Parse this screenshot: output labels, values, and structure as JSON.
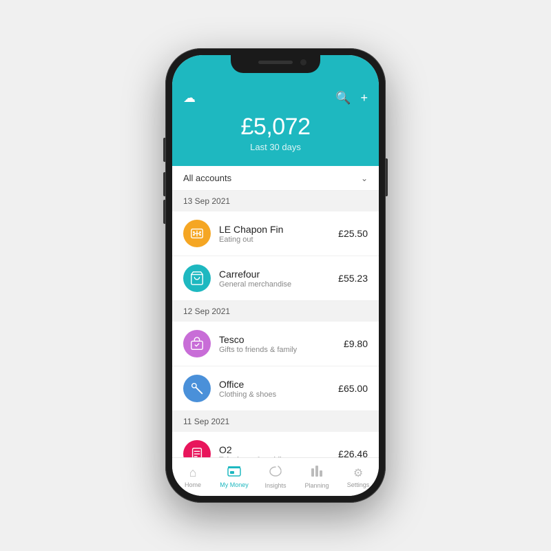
{
  "phone": {
    "header": {
      "cloud_icon": "☁",
      "search_icon": "🔍",
      "add_icon": "+",
      "balance": "£5,072",
      "balance_label": "Last 30 days"
    },
    "filter": {
      "label": "All accounts",
      "chevron": "⌄"
    },
    "sections": [
      {
        "date": "13 Sep 2021",
        "transactions": [
          {
            "name": "LE Chapon Fin",
            "category": "Eating out",
            "amount": "£25.50",
            "icon_color": "orange",
            "icon_emoji": "🍽"
          },
          {
            "name": "Carrefour",
            "category": "General merchandise",
            "amount": "£55.23",
            "icon_color": "teal",
            "icon_emoji": "🧺"
          }
        ]
      },
      {
        "date": "12 Sep 2021",
        "transactions": [
          {
            "name": "Tesco",
            "category": "Gifts to friends & family",
            "amount": "£9.80",
            "icon_color": "pink-purple",
            "icon_emoji": "🎁"
          },
          {
            "name": "Office",
            "category": "Clothing & shoes",
            "amount": "£65.00",
            "icon_color": "blue",
            "icon_emoji": "🔑"
          }
        ]
      },
      {
        "date": "11 Sep 2021",
        "transactions": [
          {
            "name": "O2",
            "category": "Telephone & mobile",
            "amount": "£26.46",
            "icon_color": "hot-pink",
            "icon_emoji": "📄"
          }
        ]
      }
    ],
    "nav": [
      {
        "label": "Home",
        "icon": "⌂",
        "active": false
      },
      {
        "label": "My Money",
        "icon": "💳",
        "active": true
      },
      {
        "label": "Insights",
        "icon": "☁",
        "active": false
      },
      {
        "label": "Planning",
        "icon": "📊",
        "active": false
      },
      {
        "label": "Settings",
        "icon": "⚙",
        "active": false
      }
    ]
  }
}
